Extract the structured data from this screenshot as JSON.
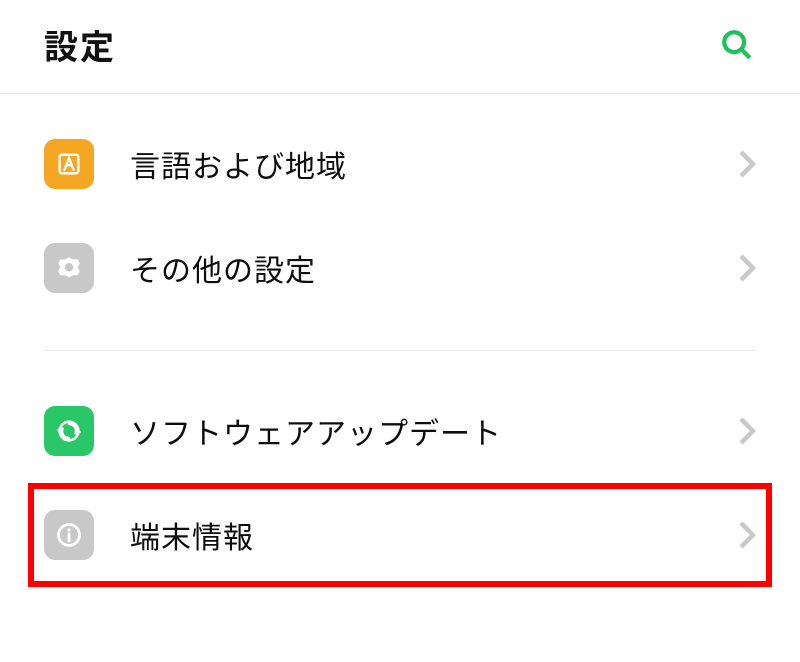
{
  "header": {
    "title": "設定"
  },
  "rows": {
    "language": {
      "label": "言語および地域"
    },
    "other": {
      "label": "その他の設定"
    },
    "update": {
      "label": "ソフトウェアアップデート"
    },
    "about": {
      "label": "端末情報"
    }
  },
  "colors": {
    "accent_green": "#1fc159",
    "highlight_red": "#ff0000",
    "icon_orange": "#f5a623",
    "icon_gray": "#c8c8c8",
    "icon_green": "#29c767"
  }
}
